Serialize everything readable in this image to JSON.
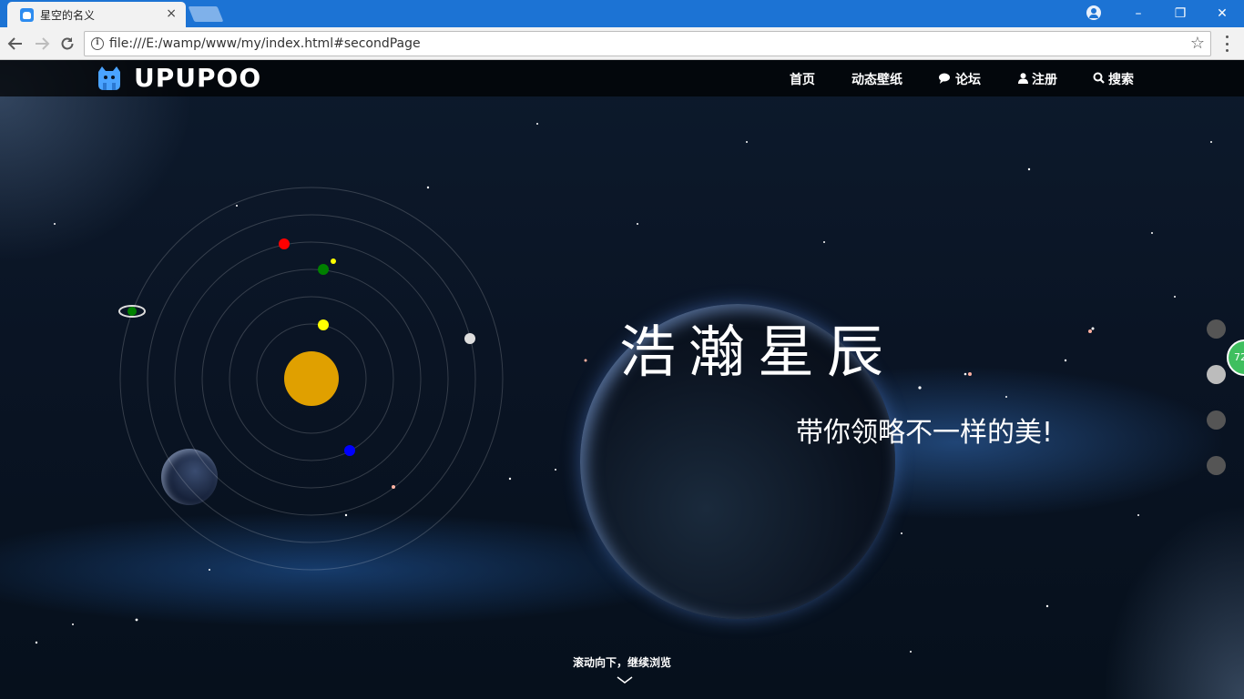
{
  "browser": {
    "tab_title": "星空的名义",
    "tab_close": "×",
    "url": "file:///E:/wamp/www/my/index.html#secondPage",
    "window_controls": {
      "minimize": "–",
      "restore": "❐",
      "close": "✕"
    },
    "icons": [
      "favicon-icon",
      "profile-icon",
      "back-arrow-icon",
      "forward-arrow-icon",
      "reload-icon",
      "info-icon",
      "star-icon",
      "menu-icon"
    ]
  },
  "site": {
    "logo_text": "UPUPOO",
    "nav": [
      {
        "label": "首页",
        "icon": ""
      },
      {
        "label": "动态壁纸",
        "icon": ""
      },
      {
        "label": "论坛",
        "icon": "comments-icon"
      },
      {
        "label": "注册",
        "icon": "user-icon"
      },
      {
        "label": "搜索",
        "icon": "search-icon"
      }
    ],
    "hero_title": "浩瀚星辰",
    "hero_subtitle": "带你领略不一样的美!",
    "scroll_hint": "滚动向下，继续浏览",
    "side_nav_count": 4,
    "side_nav_active": 1,
    "float_badge": "72"
  },
  "colors": {
    "tabbar": "#1c73d4",
    "sun": "#e0a000",
    "planet_red": "#ff0000",
    "planet_green": "#008000",
    "planet_yellow": "#ffff00",
    "planet_blue": "#0000ff",
    "planet_white": "#dddddd",
    "badge": "#3fbf5f"
  }
}
